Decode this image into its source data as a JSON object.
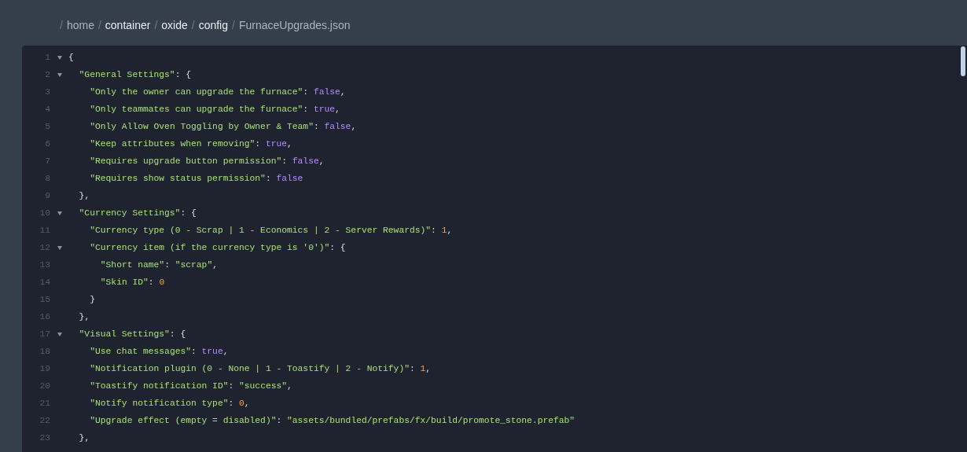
{
  "breadcrumb": {
    "separator": "/",
    "items": [
      {
        "text": "home",
        "link": false
      },
      {
        "text": "container",
        "link": true
      },
      {
        "text": "oxide",
        "link": true
      },
      {
        "text": "config",
        "link": true
      },
      {
        "text": "FurnaceUpgrades.json",
        "link": false
      }
    ]
  },
  "editor": {
    "lines": [
      {
        "number": "1",
        "foldable": true,
        "tokens": [
          {
            "kind": "bracket",
            "text": "{"
          }
        ],
        "children": [
          {
            "number": "2",
            "foldable": true,
            "tokens": [
              {
                "kind": "string",
                "text": "\"General Settings\""
              },
              {
                "kind": "plain",
                "text": ": "
              },
              {
                "kind": "bracket",
                "text": "{"
              }
            ],
            "children": [
              {
                "number": "3",
                "foldable": false,
                "tokens": [
                  {
                    "kind": "string",
                    "text": "\"Only the owner can upgrade the furnace\""
                  },
                  {
                    "kind": "plain",
                    "text": ": "
                  },
                  {
                    "kind": "boolean",
                    "text": "false"
                  },
                  {
                    "kind": "plain",
                    "text": ","
                  }
                ]
              },
              {
                "number": "4",
                "foldable": false,
                "tokens": [
                  {
                    "kind": "string",
                    "text": "\"Only teammates can upgrade the furnace\""
                  },
                  {
                    "kind": "plain",
                    "text": ": "
                  },
                  {
                    "kind": "boolean",
                    "text": "true"
                  },
                  {
                    "kind": "plain",
                    "text": ","
                  }
                ]
              },
              {
                "number": "5",
                "foldable": false,
                "tokens": [
                  {
                    "kind": "string",
                    "text": "\"Only Allow Oven Toggling by Owner & Team\""
                  },
                  {
                    "kind": "plain",
                    "text": ": "
                  },
                  {
                    "kind": "boolean",
                    "text": "false"
                  },
                  {
                    "kind": "plain",
                    "text": ","
                  }
                ]
              },
              {
                "number": "6",
                "foldable": false,
                "tokens": [
                  {
                    "kind": "string",
                    "text": "\"Keep attributes when removing\""
                  },
                  {
                    "kind": "plain",
                    "text": ": "
                  },
                  {
                    "kind": "boolean",
                    "text": "true"
                  },
                  {
                    "kind": "plain",
                    "text": ","
                  }
                ]
              },
              {
                "number": "7",
                "foldable": false,
                "tokens": [
                  {
                    "kind": "string",
                    "text": "\"Requires upgrade button permission\""
                  },
                  {
                    "kind": "plain",
                    "text": ": "
                  },
                  {
                    "kind": "boolean",
                    "text": "false"
                  },
                  {
                    "kind": "plain",
                    "text": ","
                  }
                ]
              },
              {
                "number": "8",
                "foldable": false,
                "tokens": [
                  {
                    "kind": "string",
                    "text": "\"Requires show status permission\""
                  },
                  {
                    "kind": "plain",
                    "text": ": "
                  },
                  {
                    "kind": "boolean",
                    "text": "false"
                  }
                ]
              }
            ]
          },
          {
            "number": "9",
            "foldable": false,
            "tokens": [
              {
                "kind": "bracket",
                "text": "}"
              },
              {
                "kind": "plain",
                "text": ","
              }
            ]
          },
          {
            "number": "10",
            "foldable": true,
            "tokens": [
              {
                "kind": "string",
                "text": "\"Currency Settings\""
              },
              {
                "kind": "plain",
                "text": ": "
              },
              {
                "kind": "bracket",
                "text": "{"
              }
            ],
            "children": [
              {
                "number": "11",
                "foldable": false,
                "tokens": [
                  {
                    "kind": "string",
                    "text": "\"Currency type (0 - Scrap | 1 - Economics | 2 - Server Rewards)\""
                  },
                  {
                    "kind": "plain",
                    "text": ": "
                  },
                  {
                    "kind": "number",
                    "text": "1"
                  },
                  {
                    "kind": "plain",
                    "text": ","
                  }
                ]
              },
              {
                "number": "12",
                "foldable": true,
                "tokens": [
                  {
                    "kind": "string",
                    "text": "\"Currency item (if the currency type is '0')\""
                  },
                  {
                    "kind": "plain",
                    "text": ": "
                  },
                  {
                    "kind": "bracket",
                    "text": "{"
                  }
                ],
                "children": [
                  {
                    "number": "13",
                    "foldable": false,
                    "tokens": [
                      {
                        "kind": "string",
                        "text": "\"Short name\""
                      },
                      {
                        "kind": "plain",
                        "text": ": "
                      },
                      {
                        "kind": "string",
                        "text": "\"scrap\""
                      },
                      {
                        "kind": "plain",
                        "text": ","
                      }
                    ]
                  },
                  {
                    "number": "14",
                    "foldable": false,
                    "tokens": [
                      {
                        "kind": "string",
                        "text": "\"Skin ID\""
                      },
                      {
                        "kind": "plain",
                        "text": ": "
                      },
                      {
                        "kind": "number",
                        "text": "0"
                      }
                    ]
                  }
                ]
              },
              {
                "number": "15",
                "foldable": false,
                "tokens": [
                  {
                    "kind": "bracket",
                    "text": "}"
                  }
                ]
              }
            ]
          },
          {
            "number": "16",
            "foldable": false,
            "tokens": [
              {
                "kind": "bracket",
                "text": "}"
              },
              {
                "kind": "plain",
                "text": ","
              }
            ]
          },
          {
            "number": "17",
            "foldable": true,
            "tokens": [
              {
                "kind": "string",
                "text": "\"Visual Settings\""
              },
              {
                "kind": "plain",
                "text": ": "
              },
              {
                "kind": "bracket",
                "text": "{"
              }
            ],
            "children": [
              {
                "number": "18",
                "foldable": false,
                "tokens": [
                  {
                    "kind": "string",
                    "text": "\"Use chat messages\""
                  },
                  {
                    "kind": "plain",
                    "text": ": "
                  },
                  {
                    "kind": "boolean",
                    "text": "true"
                  },
                  {
                    "kind": "plain",
                    "text": ","
                  }
                ]
              },
              {
                "number": "19",
                "foldable": false,
                "tokens": [
                  {
                    "kind": "string",
                    "text": "\"Notification plugin (0 - None | 1 - Toastify | 2 - Notify)\""
                  },
                  {
                    "kind": "plain",
                    "text": ": "
                  },
                  {
                    "kind": "number",
                    "text": "1"
                  },
                  {
                    "kind": "plain",
                    "text": ","
                  }
                ]
              },
              {
                "number": "20",
                "foldable": false,
                "tokens": [
                  {
                    "kind": "string",
                    "text": "\"Toastify notification ID\""
                  },
                  {
                    "kind": "plain",
                    "text": ": "
                  },
                  {
                    "kind": "string",
                    "text": "\"success\""
                  },
                  {
                    "kind": "plain",
                    "text": ","
                  }
                ]
              },
              {
                "number": "21",
                "foldable": false,
                "tokens": [
                  {
                    "kind": "string",
                    "text": "\"Notify notification type\""
                  },
                  {
                    "kind": "plain",
                    "text": ": "
                  },
                  {
                    "kind": "number",
                    "text": "0"
                  },
                  {
                    "kind": "plain",
                    "text": ","
                  }
                ]
              },
              {
                "number": "22",
                "foldable": false,
                "tokens": [
                  {
                    "kind": "string",
                    "text": "\"Upgrade effect (empty = disabled)\""
                  },
                  {
                    "kind": "plain",
                    "text": ": "
                  },
                  {
                    "kind": "string",
                    "text": "\"assets/bundled/prefabs/fx/build/promote_stone.prefab\""
                  }
                ]
              }
            ]
          },
          {
            "number": "23",
            "foldable": false,
            "tokens": [
              {
                "kind": "bracket",
                "text": "}"
              },
              {
                "kind": "plain",
                "text": ","
              }
            ]
          }
        ]
      }
    ]
  }
}
